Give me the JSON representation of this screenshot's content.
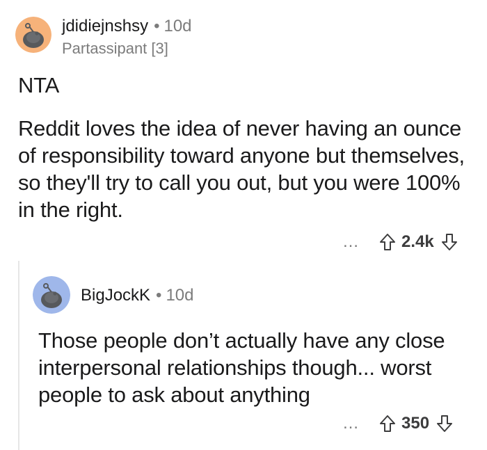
{
  "comment": {
    "username": "jdidiejnshsy",
    "age": "10d",
    "flair": "Partassipant [3]",
    "verdict": "NTA",
    "body": "Reddit loves the idea of never having an ounce of responsibility toward anyone but themselves, so they'll try to call you out, but you were 100% in the right.",
    "more": "…",
    "score": "2.4k",
    "avatar_color": "#f6b27a"
  },
  "reply": {
    "username": "BigJockK",
    "age": "10d",
    "body": "Those people don’t actually have any close interpersonal relationships though... worst people to ask about anything",
    "more": "…",
    "score": "350",
    "avatar_color": "#9fb7ea"
  },
  "separator": "•"
}
